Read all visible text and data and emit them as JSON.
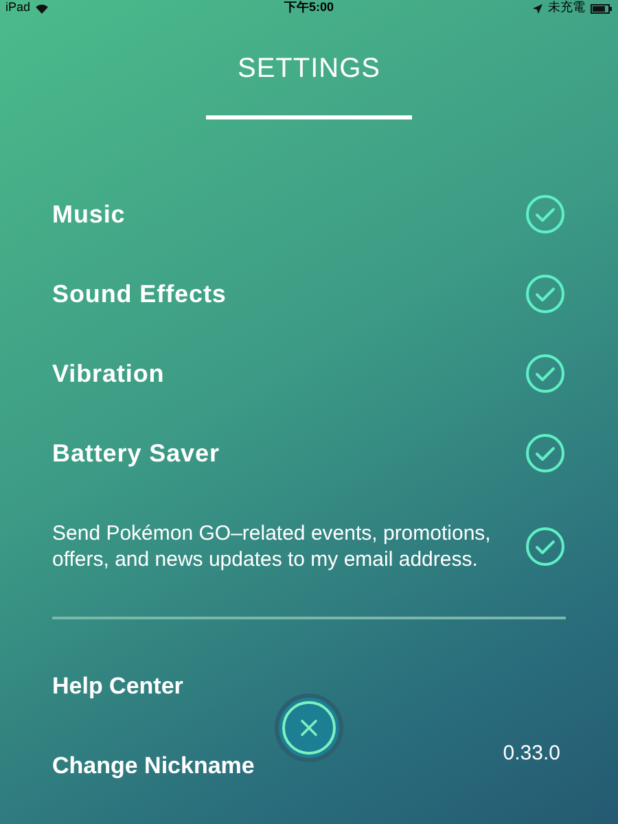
{
  "status_bar": {
    "device": "iPad",
    "time": "下午5:00",
    "battery_text": "未充電"
  },
  "title": "SETTINGS",
  "settings": [
    {
      "label": "Music",
      "kind": "toggle",
      "checked": true
    },
    {
      "label": "Sound Effects",
      "kind": "toggle",
      "checked": true
    },
    {
      "label": "Vibration",
      "kind": "toggle",
      "checked": true
    },
    {
      "label": "Battery Saver",
      "kind": "toggle",
      "checked": true
    },
    {
      "label": "Send Pokémon GO–related events, promotions, offers, and news updates to my email address.",
      "kind": "consent",
      "checked": true
    }
  ],
  "links": [
    {
      "label": "Help Center"
    },
    {
      "label": "Change Nickname"
    }
  ],
  "version": "0.33.0"
}
